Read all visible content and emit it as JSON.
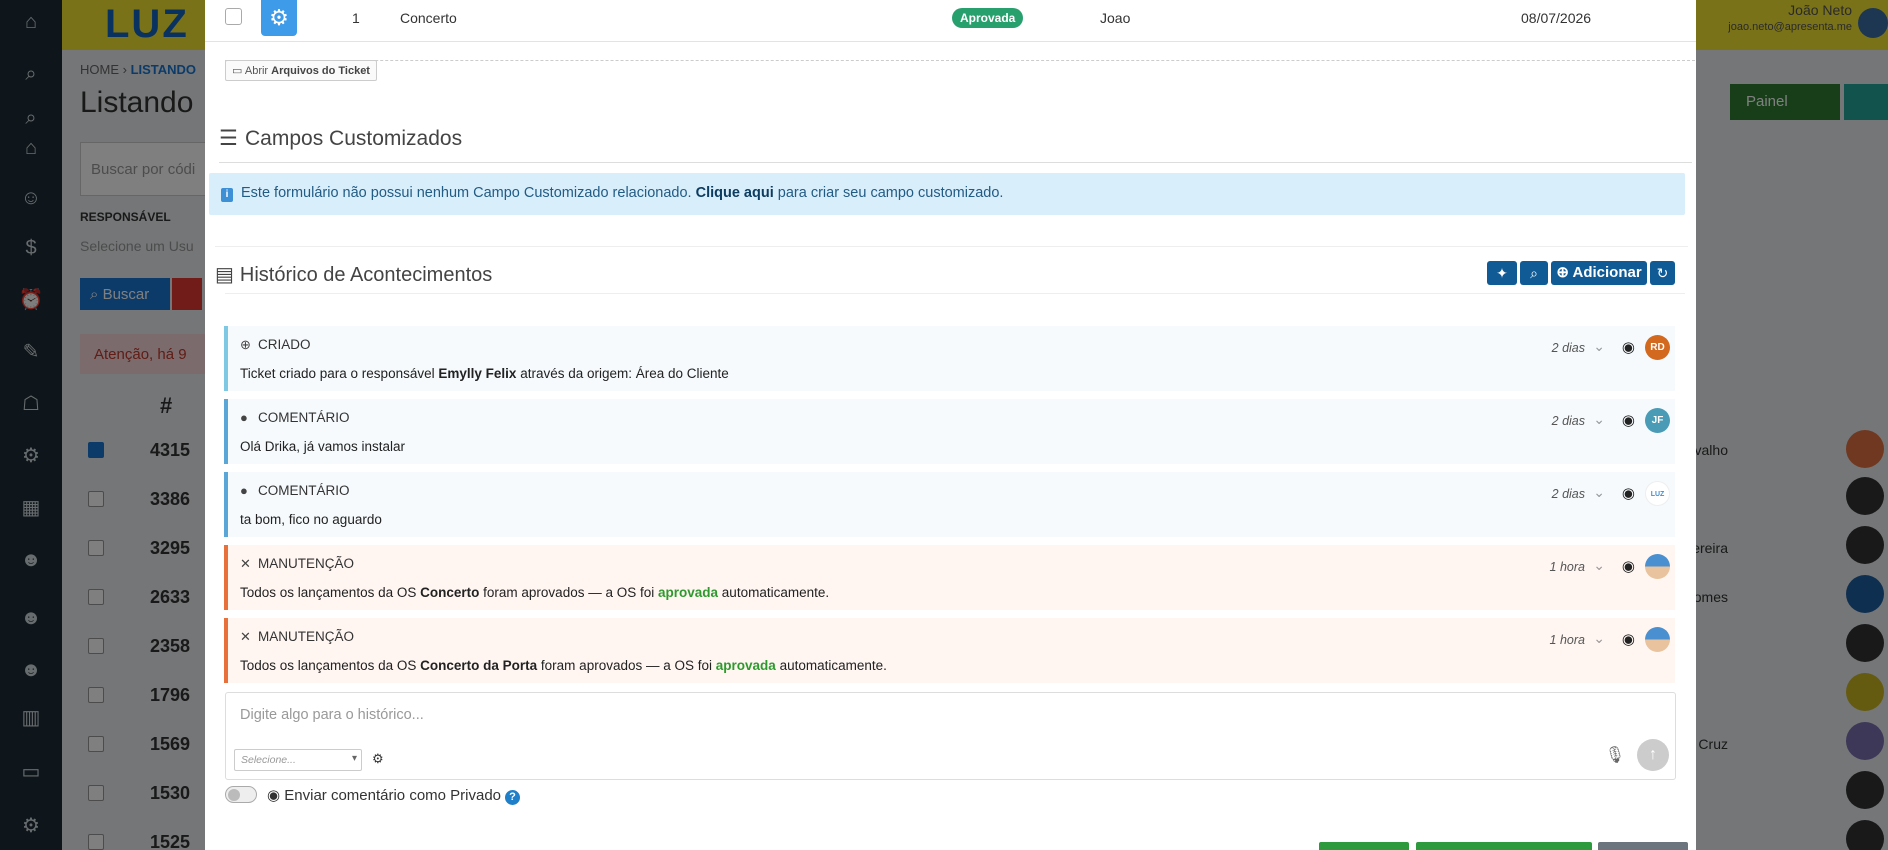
{
  "background": {
    "logo": "LUZ",
    "user_name": "João Neto",
    "user_email": "joao.neto@apresenta.me",
    "breadcrumb_home": "HOME",
    "breadcrumb_current": "LISTANDO",
    "page_title": "Listando",
    "search_placeholder": "Buscar por códi",
    "responsavel_label": "RESPONSÁVEL",
    "responsavel_placeholder": "Selecione um Usu",
    "buscar_label": "Buscar",
    "alert_text": "Atenção, há 9",
    "painel_label": "Painel",
    "hash_header": "#",
    "rows": [
      {
        "num": "4315",
        "checked": true,
        "name": "ugo Carvalho"
      },
      {
        "num": "3386",
        "checked": false,
        "name": ""
      },
      {
        "num": "3295",
        "checked": false,
        "name": "Pereira"
      },
      {
        "num": "2633",
        "checked": false,
        "name": "Gomes"
      },
      {
        "num": "2358",
        "checked": false,
        "name": ""
      },
      {
        "num": "1796",
        "checked": false,
        "name": ""
      },
      {
        "num": "1569",
        "checked": false,
        "name": "da Cruz"
      },
      {
        "num": "1530",
        "checked": false,
        "name": ""
      },
      {
        "num": "1525",
        "checked": false,
        "name": ""
      }
    ]
  },
  "os_row": {
    "index": "1",
    "name": "Concerto",
    "status": "Aprovada",
    "responsible": "Joao",
    "date": "08/07/2026"
  },
  "files_button": {
    "prefix": "Abrir",
    "label": "Arquivos do Ticket"
  },
  "custom_fields": {
    "title": "Campos Customizados",
    "info_text": "Este formulário não possui nenhum Campo Customizado relacionado.",
    "info_link": "Clique aqui",
    "info_suffix": "para criar seu campo customizado."
  },
  "history": {
    "title": "Histórico de Acontecimentos",
    "add_label": "Adicionar",
    "events": [
      {
        "type": "CRIADO",
        "when": "2 dias",
        "avatar": "RD",
        "avatar_color": "#d2691e"
      },
      {
        "type": "COMENTÁRIO",
        "when": "2 dias",
        "avatar": "JF",
        "avatar_color": "#4a9bb5",
        "text": "Olá Drika, já vamos instalar"
      },
      {
        "type": "COMENTÁRIO",
        "when": "2 dias",
        "avatar": "LUZ",
        "avatar_color": "#ffffff",
        "text": "ta bom, fico no aguardo"
      },
      {
        "type": "MANUTENÇÃO",
        "when": "1 hora",
        "avatar": "",
        "avatar_color": "#4a8fd0"
      },
      {
        "type": "MANUTENÇÃO",
        "when": "1 hora",
        "avatar": "",
        "avatar_color": "#4a8fd0"
      }
    ],
    "event0": {
      "pre": "Ticket criado para o responsável",
      "bold": "Emylly Felix",
      "post": "através da origem: Área do Cliente"
    },
    "event3": {
      "pre": "Todos os lançamentos da OS",
      "bold": "Concerto",
      "mid": "foram aprovados — a OS foi",
      "ok": "aprovada",
      "post": "automaticamente."
    },
    "event4": {
      "pre": "Todos os lançamentos da OS",
      "bold": "Concerto da Porta",
      "mid": "foram aprovados — a OS foi",
      "ok": "aprovada",
      "post": "automaticamente."
    },
    "composer_placeholder": "Digite algo para o histórico...",
    "select_placeholder": "Selecione...",
    "private_label": "Enviar comentário como Privado"
  },
  "colors": {
    "primary": "#105b96",
    "success": "#28a06e",
    "info_bg": "#d9eefb",
    "maintenance_border": "#e8703a"
  }
}
